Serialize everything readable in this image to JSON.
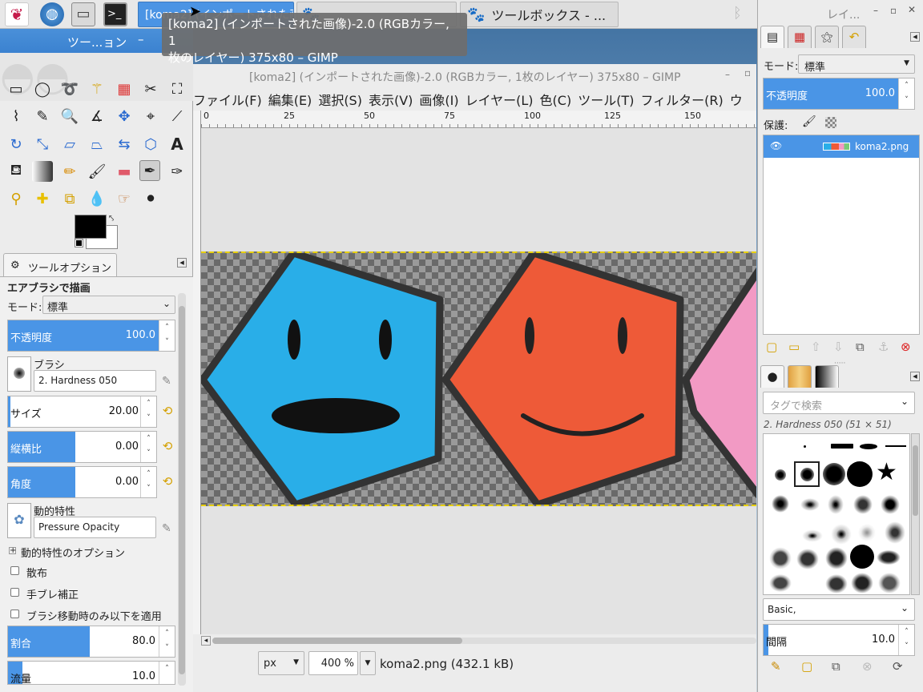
{
  "taskbar": {
    "tasks": [
      {
        "label": "[koma2] (インポートされた画像)-2.0 ..."
      },
      {
        "label": ""
      },
      {
        "label": "ツールボックス - ..."
      }
    ]
  },
  "tooltip": {
    "line1": "[koma2] (インポートされた画像)-2.0 (RGBカラー, 1",
    "line2": "枚のレイヤー) 375x80 – GIMP"
  },
  "toolbox": {
    "title": "ツー...ョン",
    "options_tab": "ツールオプション",
    "tool_heading": "エアブラシで描画",
    "mode_label": "モード:",
    "mode_value": "標準",
    "opacity": {
      "label": "不透明度",
      "value": "100.0",
      "fraction": 1.0
    },
    "brush_label": "ブラシ",
    "brush_value": "2. Hardness 050",
    "size": {
      "label": "サイズ",
      "value": "20.00"
    },
    "aspect": {
      "label": "縦横比",
      "value": "0.00"
    },
    "angle": {
      "label": "角度",
      "value": "0.00"
    },
    "dynamics_label": "動的特性",
    "dynamics_value": "Pressure Opacity",
    "dynamics_options": "動的特性のオプション",
    "scatter": "散布",
    "smoothing": "手ブレ補正",
    "apply_only_moving": "ブラシ移動時のみ以下を適用",
    "rate": {
      "label": "割合",
      "value": "80.0"
    },
    "flow": {
      "label": "流量",
      "value": "10.0"
    }
  },
  "image_window": {
    "title": "[koma2] (インポートされた画像)-2.0 (RGBカラー, 1枚のレイヤー) 375x80 – GIMP",
    "menu": [
      "ファイル(F)",
      "編集(E)",
      "選択(S)",
      "表示(V)",
      "画像(I)",
      "レイヤー(L)",
      "色(C)",
      "ツール(T)",
      "フィルター(R)",
      "ウ"
    ],
    "ruler_ticks": [
      "0",
      "25",
      "50",
      "75",
      "100",
      "125",
      "150"
    ],
    "unit": "px",
    "zoom": "400 %",
    "status": "koma2.png (432.1 kB)"
  },
  "dock": {
    "title": "レイ...",
    "mode_label": "モード:",
    "mode_value": "標準",
    "opacity": {
      "label": "不透明度",
      "value": "100.0"
    },
    "lock_label": "保護:",
    "layer_name": "koma2.png",
    "tag_placeholder": "タグで検索",
    "brush_info": "2. Hardness 050 (51 × 51)",
    "brush_set": "Basic,",
    "spacing": {
      "label": "間隔",
      "value": "10.0"
    }
  },
  "colors": {
    "accent": "#4a95e6",
    "face_blue": "#29aee8",
    "face_orange": "#ee5a38",
    "face_pink": "#f29ac4"
  }
}
